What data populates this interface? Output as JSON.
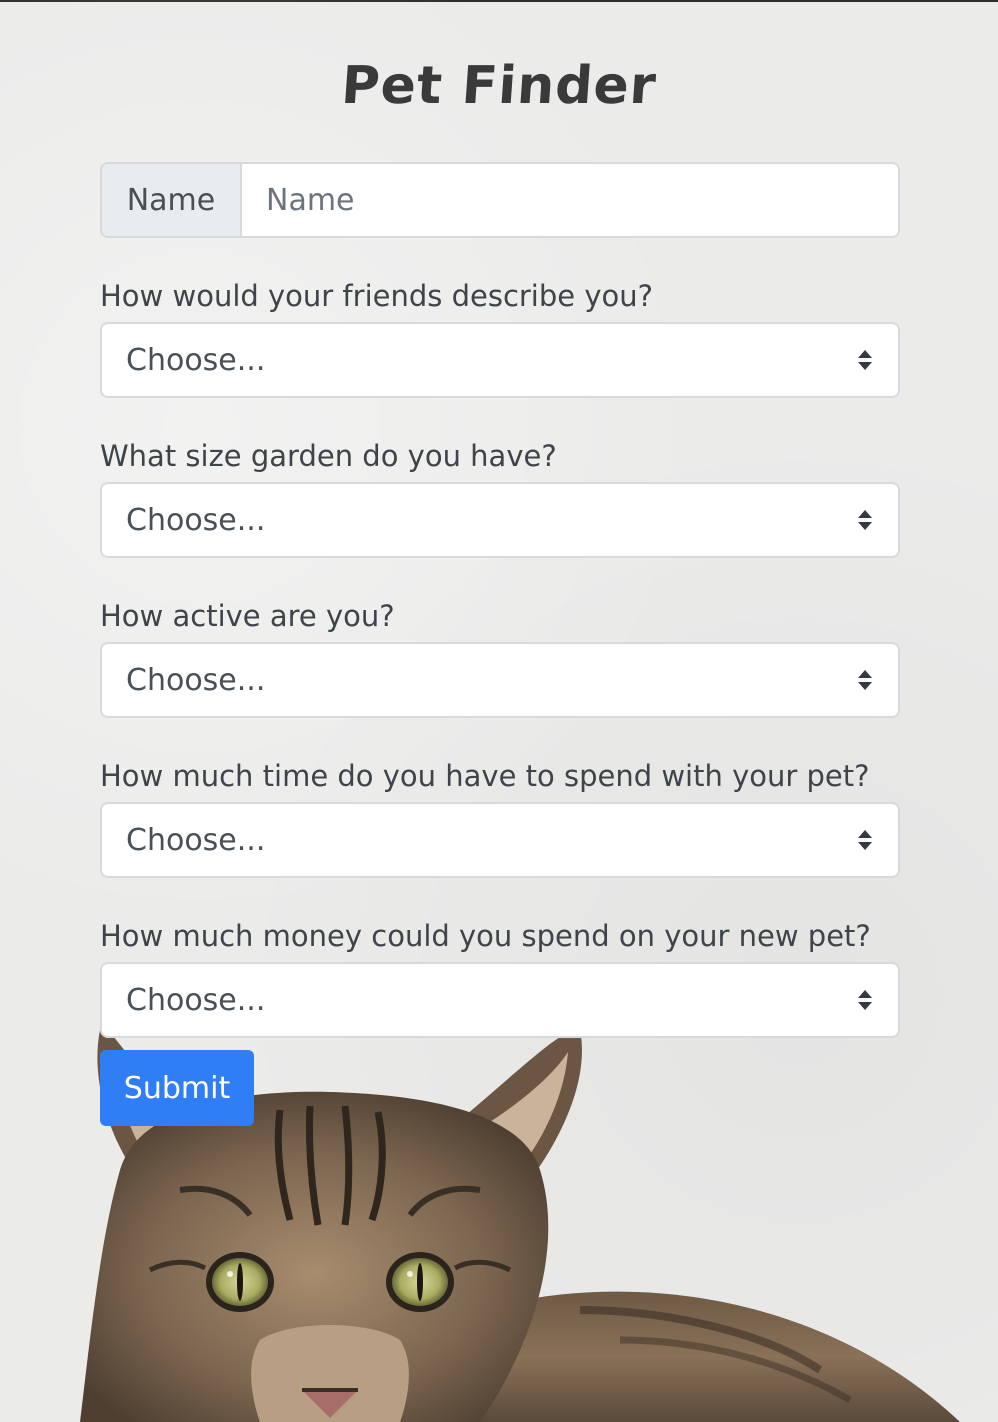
{
  "page": {
    "title": "Pet Finder"
  },
  "name_field": {
    "label": "Name",
    "placeholder": "Name",
    "value": ""
  },
  "questions": [
    {
      "label": "How would your friends describe you?",
      "selected": "Choose..."
    },
    {
      "label": "What size garden do you have?",
      "selected": "Choose..."
    },
    {
      "label": "How active are you?",
      "selected": "Choose..."
    },
    {
      "label": "How much time do you have to spend with your pet?",
      "selected": "Choose..."
    },
    {
      "label": "How much money could you spend on your new pet?",
      "selected": "Choose..."
    }
  ],
  "submit": {
    "label": "Submit"
  },
  "colors": {
    "background": "#ebebea",
    "accent": "#2f7ef6",
    "input_addon": "#e9ecef"
  },
  "icons": {
    "select_caret": "up-down-caret-icon",
    "background_image": "tabby-cat-illustration"
  }
}
